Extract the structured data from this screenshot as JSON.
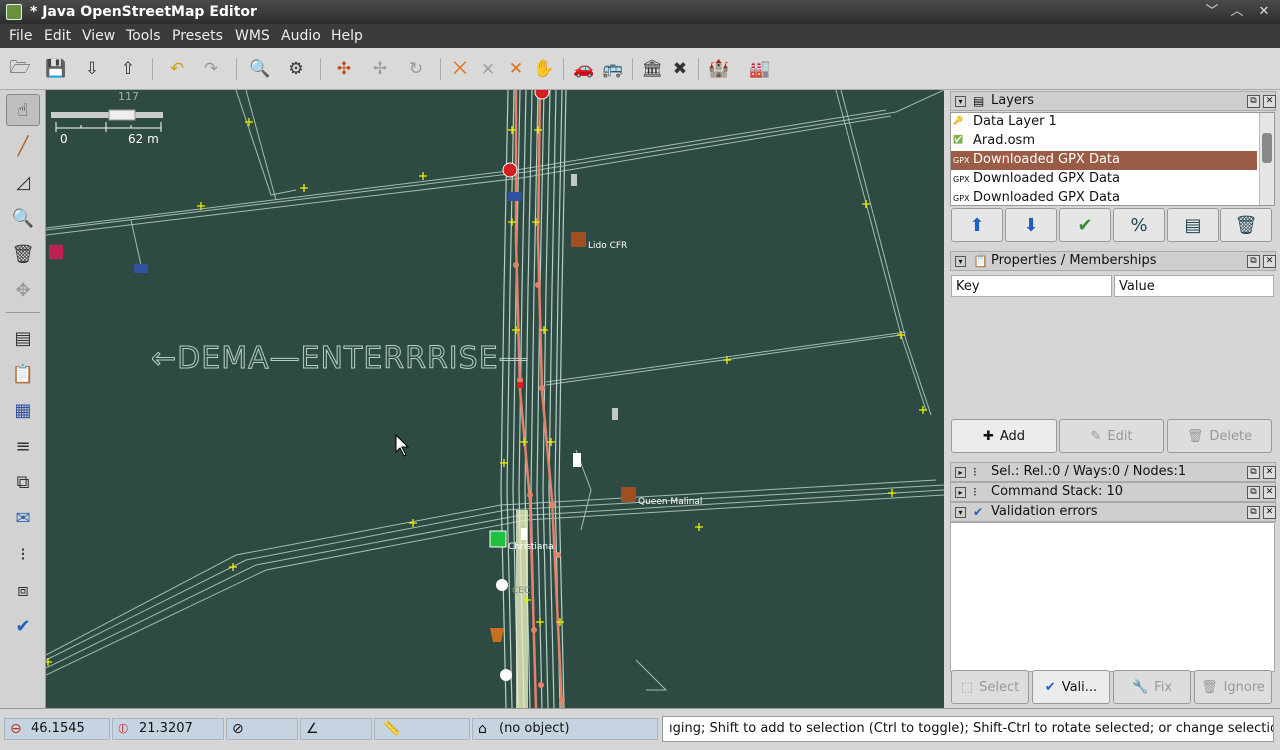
{
  "window": {
    "title": "* Java OpenStreetMap Editor",
    "controls": [
      "﹀",
      "︿",
      "✕"
    ]
  },
  "menu": [
    "File",
    "Edit",
    "View",
    "Tools",
    "Presets",
    "WMS",
    "Audio",
    "Help"
  ],
  "map": {
    "scale": {
      "left": "0",
      "right": "62 m",
      "top_number": "117"
    },
    "labels": [
      "Lido CFR",
      "Queen Malinal",
      "Christiana",
      "CEC"
    ],
    "watermark": "←DEMA—ENTERRRISE—",
    "colors": {
      "background": "#2e4b43",
      "track": "#b8cfc9",
      "road": "#e2826a",
      "node": "#f0f000"
    }
  },
  "panels": {
    "layers": {
      "title": "Layers",
      "items": [
        {
          "icon": "data-layer-icon",
          "label": "Data Layer 1"
        },
        {
          "icon": "osm-file-icon",
          "label": "Arad.osm"
        },
        {
          "icon": "gpx-icon",
          "tag": "GPX",
          "label": "Downloaded GPX Data"
        },
        {
          "icon": "gpx-icon",
          "tag": "GPX",
          "label": "Downloaded GPX Data"
        },
        {
          "icon": "gpx-icon",
          "tag": "GPX",
          "label": "Downloaded GPX Data"
        }
      ]
    },
    "properties": {
      "title": "Properties / Memberships",
      "col_key": "Key",
      "col_value": "Value",
      "add": "Add",
      "edit": "Edit",
      "delete": "Delete"
    },
    "selection": {
      "title": "Sel.: Rel.:0 / Ways:0 / Nodes:1"
    },
    "command_stack": {
      "title": "Command Stack: 10"
    },
    "validation": {
      "title": "Validation errors",
      "select": "Select",
      "validate": "Vali...",
      "fix": "Fix",
      "ignore": "Ignore"
    }
  },
  "status": {
    "lat": "46.1545",
    "lon": "21.3207",
    "object": "(no object)",
    "help": "ıging; Shift to add to selection (Ctrl to toggle); Shift-Ctrl to rotate selected; or change selection"
  }
}
